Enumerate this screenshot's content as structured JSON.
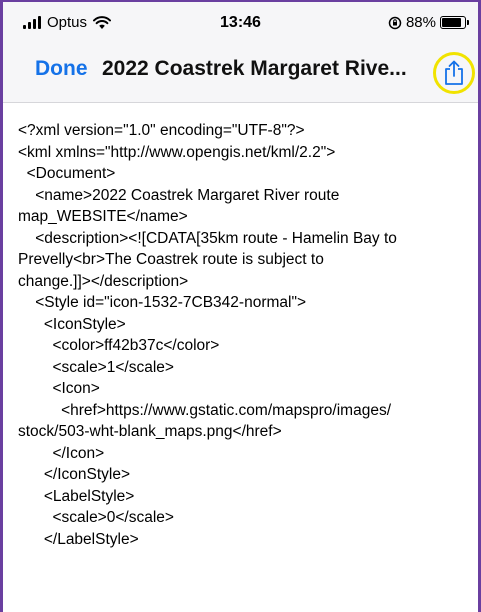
{
  "status_bar": {
    "carrier": "Optus",
    "time": "13:46",
    "battery_percent": "88%",
    "battery_level": 0.88
  },
  "nav": {
    "done_label": "Done",
    "title": "2022 Coastrek Margaret Rive...",
    "share_icon": "share-icon"
  },
  "document": {
    "lines": [
      "<?xml version=\"1.0\" encoding=\"UTF-8\"?>",
      "<kml xmlns=\"http://www.opengis.net/kml/2.2\">",
      "  <Document>",
      "    <name>2022 Coastrek Margaret River route",
      "map_WEBSITE</name>",
      "    <description><![CDATA[35km route - Hamelin Bay to",
      "Prevelly<br>The Coastrek route is subject to",
      "change.]]></description>",
      "    <Style id=\"icon-1532-7CB342-normal\">",
      "      <IconStyle>",
      "        <color>ff42b37c</color>",
      "        <scale>1</scale>",
      "        <Icon>",
      "          <href>https://www.gstatic.com/mapspro/images/",
      "stock/503-wht-blank_maps.png</href>",
      "        </Icon>",
      "      </IconStyle>",
      "      <LabelStyle>",
      "        <scale>0</scale>",
      "      </LabelStyle>"
    ]
  },
  "colors": {
    "accent": "#1572e8",
    "highlight_ring": "#f1e300",
    "frame": "#6a3fa0"
  }
}
